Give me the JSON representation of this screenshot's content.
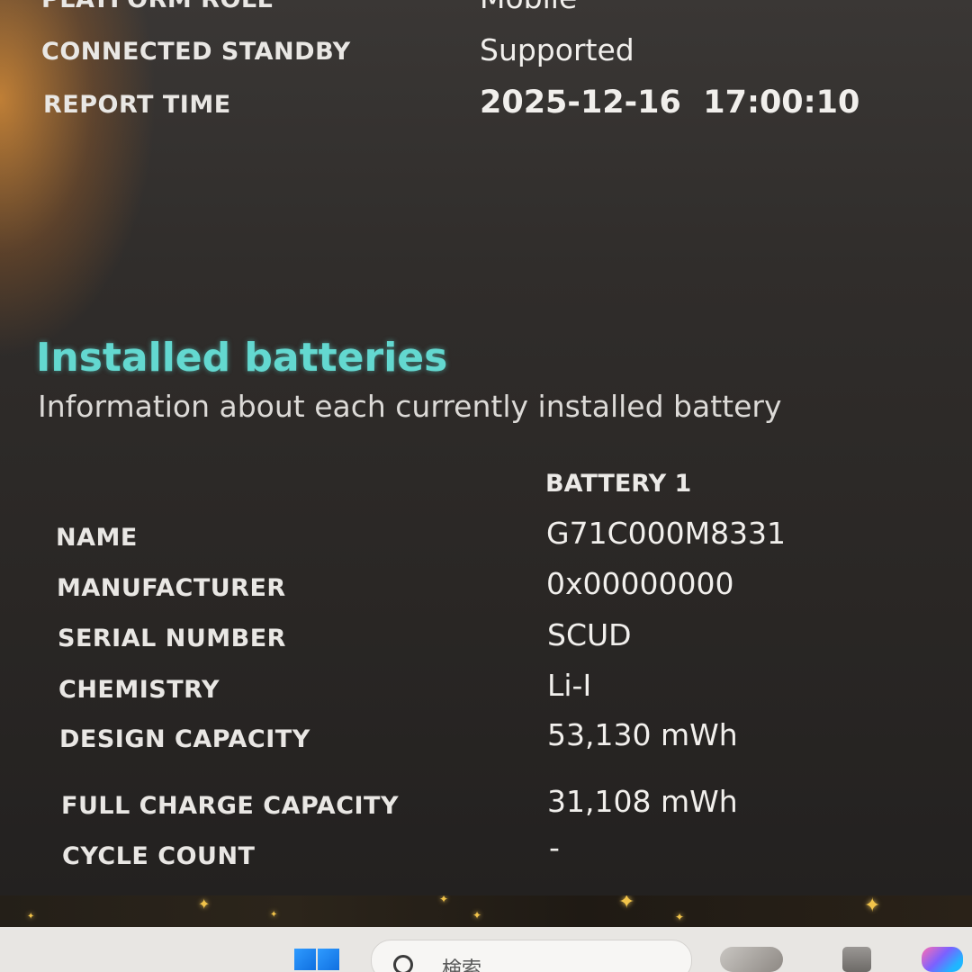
{
  "system_info": {
    "rows": [
      {
        "label": "PLATFORM ROLE",
        "value": "Mobile"
      },
      {
        "label": "CONNECTED STANDBY",
        "value": "Supported"
      },
      {
        "label": "REPORT TIME",
        "value": "2025-12-16  17:00:10"
      }
    ]
  },
  "installed_batteries": {
    "title": "Installed batteries",
    "subtitle": "Information about each currently installed battery",
    "column_header": "BATTERY 1",
    "rows": [
      {
        "label": "NAME",
        "value": "G71C000M8331"
      },
      {
        "label": "MANUFACTURER",
        "value": "0x00000000"
      },
      {
        "label": "SERIAL NUMBER",
        "value": "SCUD"
      },
      {
        "label": "CHEMISTRY",
        "value": "Li-I"
      },
      {
        "label": "DESIGN CAPACITY",
        "value": "53,130 mWh"
      },
      {
        "label": "FULL CHARGE CAPACITY",
        "value": "31,108 mWh"
      },
      {
        "label": "CYCLE COUNT",
        "value": "-"
      }
    ]
  },
  "taskbar": {
    "search_placeholder": "検索",
    "icons": [
      "start-icon",
      "search-icon",
      "media-icon",
      "file-explorer-icon",
      "copilot-icon"
    ]
  },
  "colors": {
    "section_title": "#63d8d0",
    "label_text": "#e9e7e4",
    "background": "#2a2725"
  }
}
